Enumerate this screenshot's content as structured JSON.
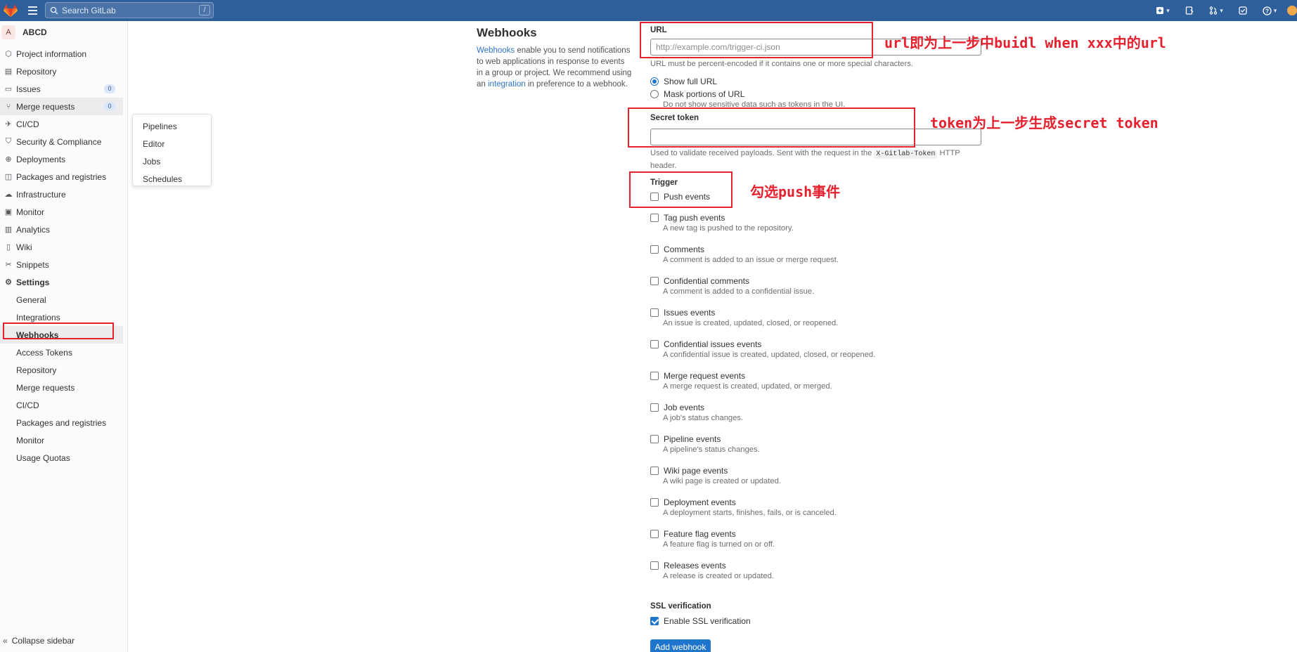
{
  "topbar": {
    "search_placeholder": "Search GitLab",
    "search_shortcut": "/",
    "icons": [
      "plus-square-icon",
      "issues-icon",
      "merge-request-icon",
      "todo-icon",
      "help-icon",
      "avatar"
    ]
  },
  "sidebar": {
    "project_initial": "A",
    "project_name": "ABCD",
    "items": [
      {
        "label": "Project information",
        "icon": "info-icon"
      },
      {
        "label": "Repository",
        "icon": "doc-icon"
      },
      {
        "label": "Issues",
        "icon": "issues-icon",
        "badge": "0"
      },
      {
        "label": "Merge requests",
        "icon": "merge-request-icon",
        "badge": "0"
      },
      {
        "label": "CI/CD",
        "icon": "rocket-icon"
      },
      {
        "label": "Security & Compliance",
        "icon": "shield-icon"
      },
      {
        "label": "Deployments",
        "icon": "deploy-icon"
      },
      {
        "label": "Packages and registries",
        "icon": "package-icon"
      },
      {
        "label": "Infrastructure",
        "icon": "cloud-icon"
      },
      {
        "label": "Monitor",
        "icon": "monitor-icon"
      },
      {
        "label": "Analytics",
        "icon": "chart-icon"
      },
      {
        "label": "Wiki",
        "icon": "book-icon"
      },
      {
        "label": "Snippets",
        "icon": "scissors-icon"
      },
      {
        "label": "Settings",
        "icon": "gear-icon"
      }
    ],
    "settings_sub": [
      "General",
      "Integrations",
      "Webhooks",
      "Access Tokens",
      "Repository",
      "Merge requests",
      "CI/CD",
      "Packages and registries",
      "Monitor",
      "Usage Quotas"
    ],
    "collapse_label": "Collapse sidebar"
  },
  "flyout": [
    "Pipelines",
    "Editor",
    "Jobs",
    "Schedules"
  ],
  "page": {
    "title": "Webhooks",
    "desc_link1": "Webhooks",
    "desc_part1": " enable you to send notifications to web applications in response to events in a group or project. We recommend using an ",
    "desc_link2": "integration",
    "desc_part2": " in preference to a webhook."
  },
  "form": {
    "url_label": "URL",
    "url_placeholder": "http://example.com/trigger-ci.json",
    "url_help": "URL must be percent-encoded if it contains one or more special characters.",
    "radio_show": "Show full URL",
    "radio_mask": "Mask portions of URL",
    "radio_mask_help": "Do not show sensitive data such as tokens in the UI.",
    "token_label": "Secret token",
    "token_help_1": "Used to validate received payloads. Sent with the request in the ",
    "token_help_code": "X-Gitlab-Token",
    "token_help_2": " HTTP header.",
    "trigger_label": "Trigger",
    "triggers": [
      {
        "label": "Push events",
        "desc": ""
      },
      {
        "label": "Tag push events",
        "desc": "A new tag is pushed to the repository."
      },
      {
        "label": "Comments",
        "desc": "A comment is added to an issue or merge request."
      },
      {
        "label": "Confidential comments",
        "desc": "A comment is added to a confidential issue."
      },
      {
        "label": "Issues events",
        "desc": "An issue is created, updated, closed, or reopened."
      },
      {
        "label": "Confidential issues events",
        "desc": "A confidential issue is created, updated, closed, or reopened."
      },
      {
        "label": "Merge request events",
        "desc": "A merge request is created, updated, or merged."
      },
      {
        "label": "Job events",
        "desc": "A job's status changes."
      },
      {
        "label": "Pipeline events",
        "desc": "A pipeline's status changes."
      },
      {
        "label": "Wiki page events",
        "desc": "A wiki page is created or updated."
      },
      {
        "label": "Deployment events",
        "desc": "A deployment starts, finishes, fails, or is canceled."
      },
      {
        "label": "Feature flag events",
        "desc": "A feature flag is turned on or off."
      },
      {
        "label": "Releases events",
        "desc": "A release is created or updated."
      }
    ],
    "ssl_label": "SSL verification",
    "ssl_check": "Enable SSL verification",
    "submit": "Add webhook"
  },
  "annotations": {
    "url_note": "url即为上一步中buidl when xxx中的url",
    "token_note": "token为上一步生成secret token",
    "trigger_note": "勾选push事件",
    "color": "#e5212f"
  }
}
